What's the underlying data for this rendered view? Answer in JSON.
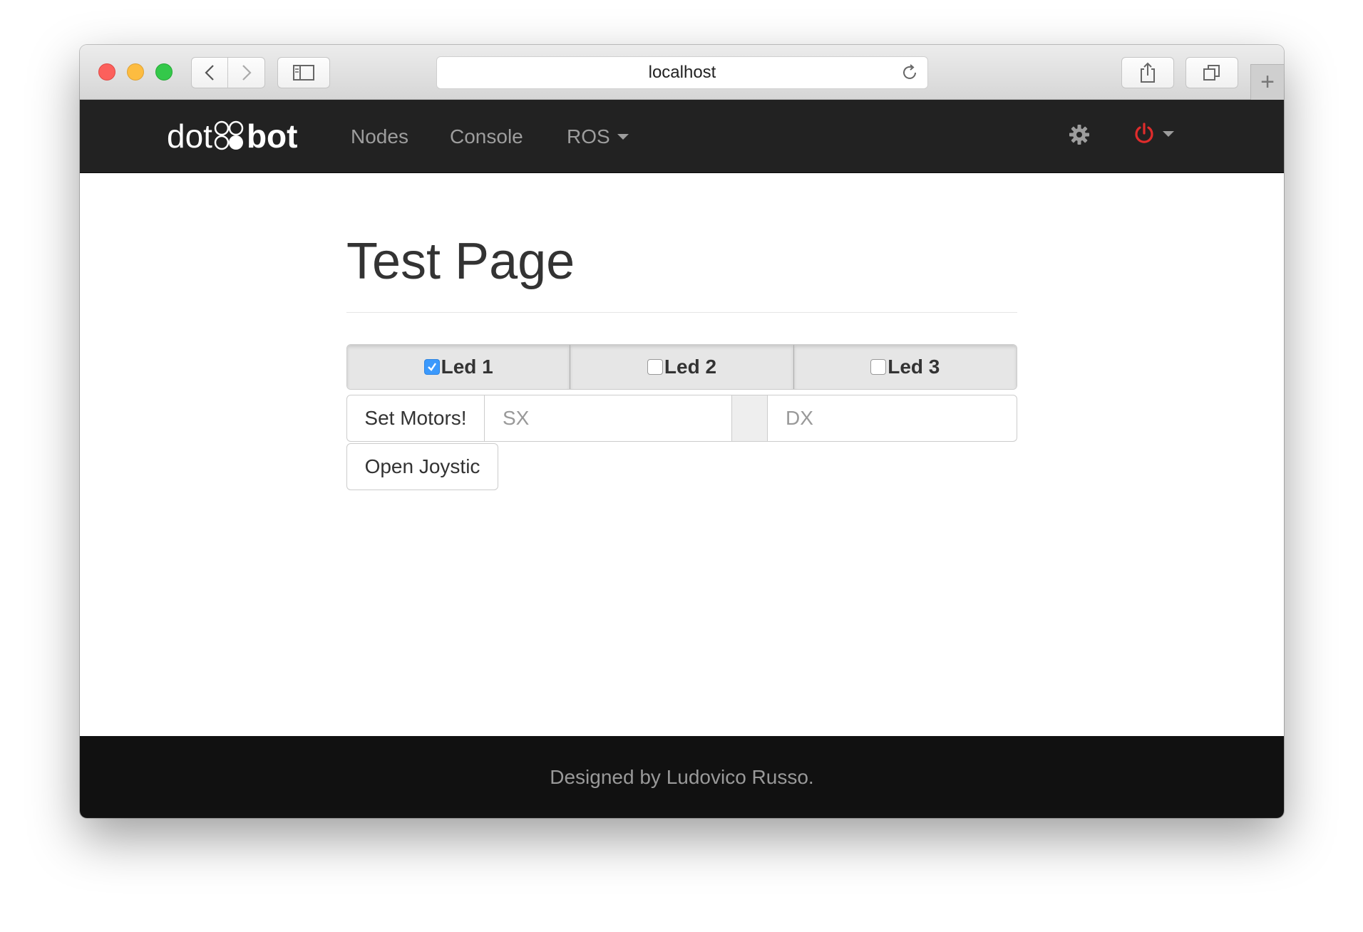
{
  "browser": {
    "url": "localhost"
  },
  "navbar": {
    "brand_light": "dot",
    "brand_bold": "bot",
    "links": [
      "Nodes",
      "Console",
      "ROS"
    ],
    "power_color": "#e02c2c"
  },
  "page": {
    "title": "Test Page",
    "leds": [
      {
        "label": "Led 1",
        "checked": true
      },
      {
        "label": "Led 2",
        "checked": false
      },
      {
        "label": "Led 3",
        "checked": false
      }
    ],
    "set_motors_label": "Set Motors!",
    "sx_placeholder": "SX",
    "dx_placeholder": "DX",
    "joystick_label": "Open Joystic"
  },
  "footer": {
    "text": "Designed by Ludovico Russo."
  },
  "colors": {
    "navbar_bg": "#222222",
    "footer_bg": "#111111",
    "checkbox_accent": "#3b99fc"
  }
}
